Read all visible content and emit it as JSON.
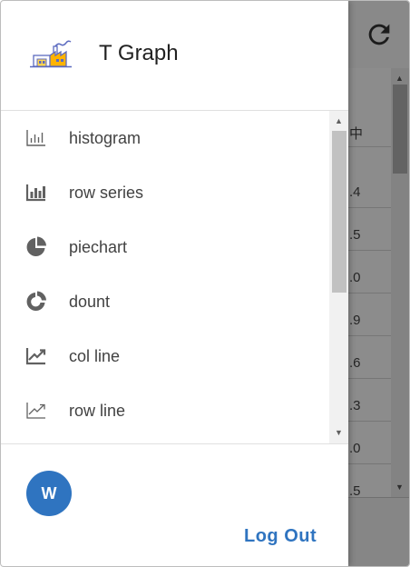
{
  "app": {
    "title": "T Graph",
    "logo_icon": "factory-icon"
  },
  "menu": {
    "items": [
      {
        "label": "histogram",
        "icon": "histogram-outline-icon"
      },
      {
        "label": "row series",
        "icon": "bar-chart-icon"
      },
      {
        "label": "piechart",
        "icon": "pie-chart-icon"
      },
      {
        "label": "dount",
        "icon": "donut-chart-icon"
      },
      {
        "label": "col line",
        "icon": "trending-up-icon"
      },
      {
        "label": "row line",
        "icon": "trending-up-outline-icon"
      }
    ]
  },
  "user": {
    "avatar_initial": "W",
    "avatar_color": "#2f74c0"
  },
  "actions": {
    "logout_label": "Log Out"
  },
  "background": {
    "refresh_icon": "refresh-icon",
    "table_header": "中",
    "table_values": [
      ".4",
      ".5",
      ".0",
      ".9",
      ".6",
      ".3",
      ".0",
      ".5"
    ]
  }
}
